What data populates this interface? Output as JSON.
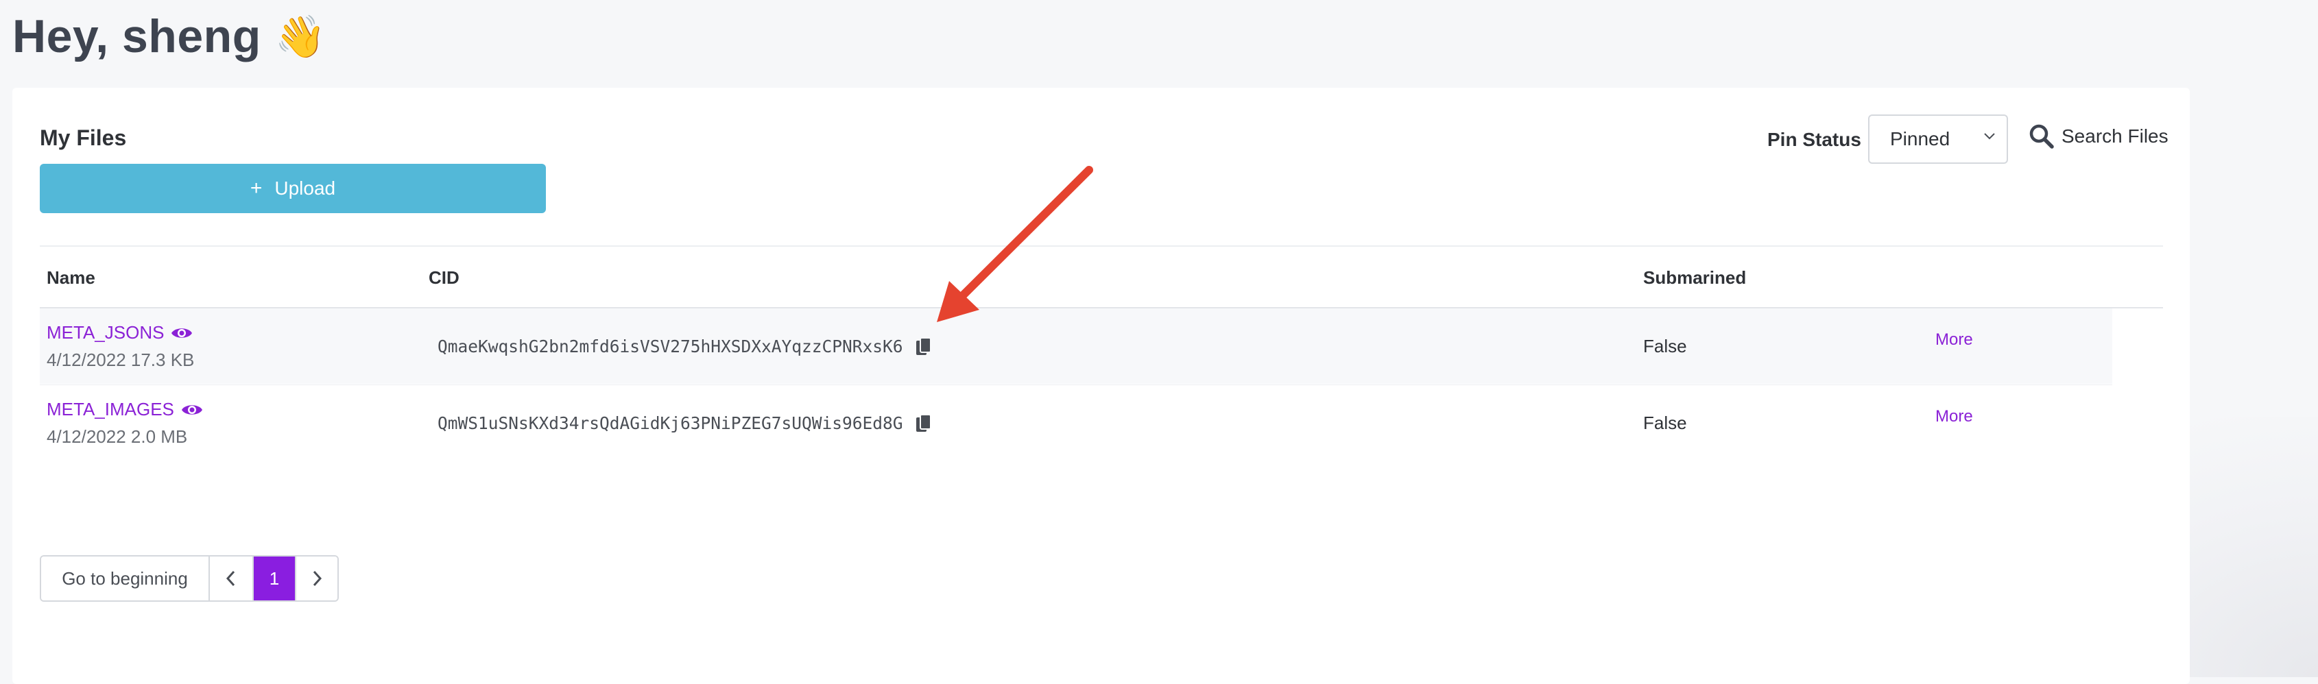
{
  "header": {
    "greeting": "Hey, sheng",
    "wave_emoji": "👋"
  },
  "card": {
    "title": "My Files",
    "upload_label": "Upload",
    "upload_icon": "+",
    "pin_status_label": "Pin Status",
    "pin_status_value": "Pinned",
    "search_label": "Search Files"
  },
  "table": {
    "columns": [
      "Name",
      "CID",
      "Submarined"
    ],
    "rows": [
      {
        "name": "META_JSONS",
        "meta": "4/12/2022 17.3 KB",
        "cid": "QmaeKwqshG2bn2mfd6isVSV275hHXSDXxAYqzzCPNRxsK6",
        "submarined": "False",
        "more": "More"
      },
      {
        "name": "META_IMAGES",
        "meta": "4/12/2022 2.0 MB",
        "cid": "QmWS1uSNsKXd34rsQdAGidKj63PNiPZEG7sUQWis96Ed8G",
        "submarined": "False",
        "more": "More"
      }
    ]
  },
  "pagination": {
    "go_to_beginning": "Go to beginning",
    "prev_icon": "chevron-left-icon",
    "current_page": "1",
    "next_icon": "chevron-right-icon"
  },
  "colors": {
    "accent_purple": "#8b22d6",
    "upload_blue": "#53b8d8",
    "arrow_red": "#e5432f"
  }
}
